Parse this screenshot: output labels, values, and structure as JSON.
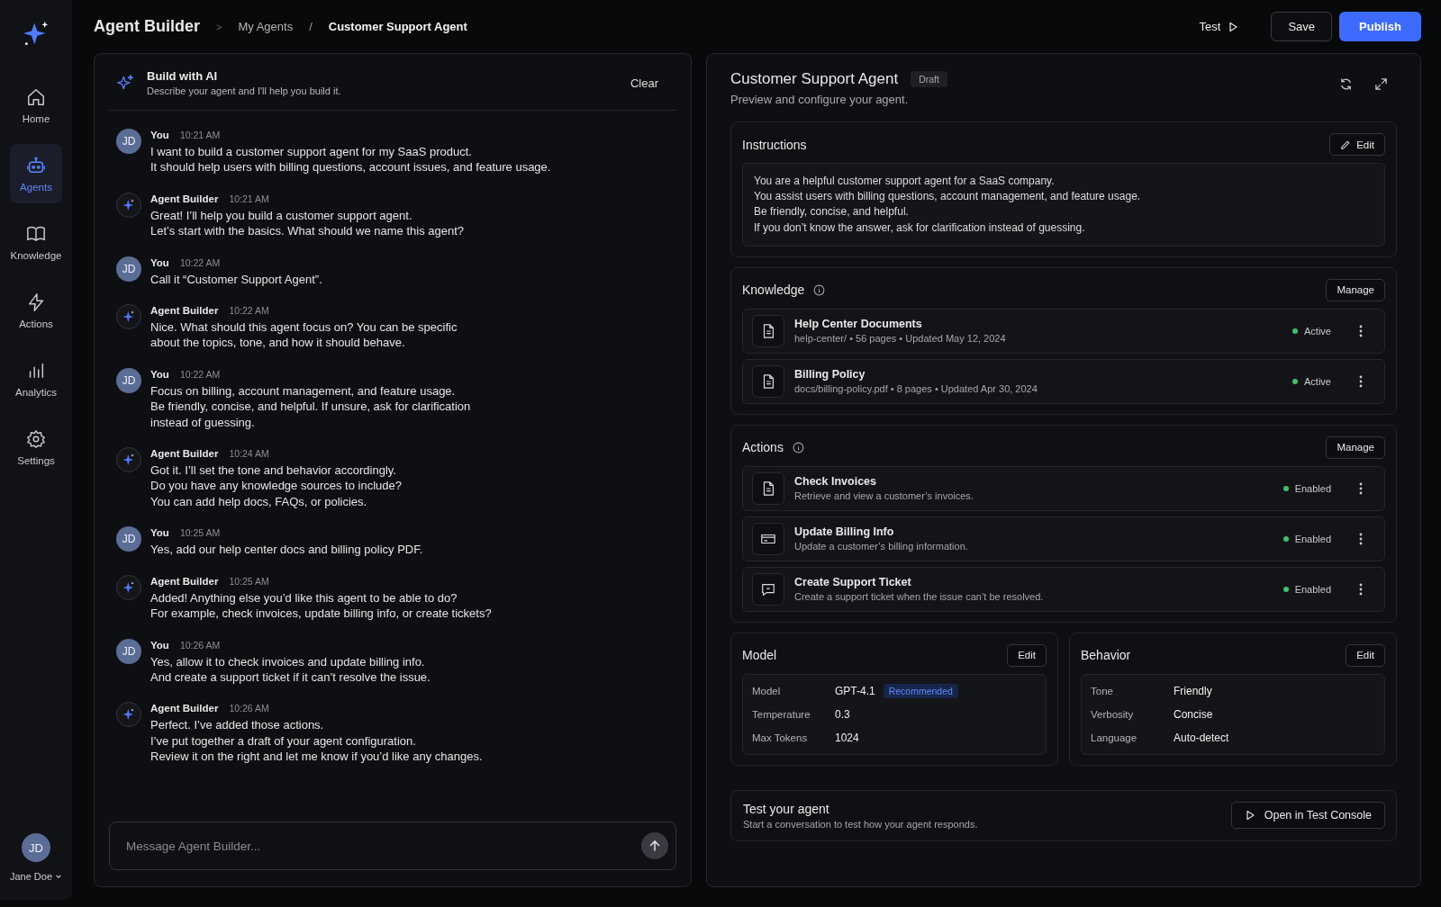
{
  "sidebar": {
    "items": [
      {
        "label": "Home",
        "selected": false
      },
      {
        "label": "Agents",
        "selected": true
      },
      {
        "label": "Knowledge",
        "selected": false
      },
      {
        "label": "Actions",
        "selected": false
      },
      {
        "label": "Analytics",
        "selected": false
      },
      {
        "label": "Settings",
        "selected": false
      }
    ],
    "user": {
      "initials": "JD",
      "name": "Jane Doe"
    }
  },
  "header": {
    "title": "Agent Builder",
    "breadcrumb": [
      "My Agents",
      "Customer Support Agent"
    ],
    "separator_1": ">",
    "separator_2": "/",
    "test": "Test",
    "save": "Save",
    "publish": "Publish"
  },
  "chat": {
    "title": "Build with AI",
    "subtitle": "Describe your agent and I'll help you build it.",
    "clear": "Clear",
    "messages": [
      {
        "kind": "user",
        "avatar": "JD",
        "author": "You",
        "time": "10:21 AM",
        "lines": [
          "I want to build a customer support agent for my SaaS product.",
          "It should help users with billing questions, account issues, and feature usage."
        ]
      },
      {
        "kind": "agent",
        "author": "Agent Builder",
        "time": "10:21 AM",
        "lines": [
          "Great! I’ll help you build a customer support agent.",
          "Let’s start with the basics. What should we name this agent?"
        ]
      },
      {
        "kind": "user",
        "avatar": "JD",
        "author": "You",
        "time": "10:22 AM",
        "lines": [
          "Call it “Customer Support Agent”."
        ]
      },
      {
        "kind": "agent",
        "author": "Agent Builder",
        "time": "10:22 AM",
        "lines": [
          "Nice. What should this agent focus on? You can be specific",
          "about the topics, tone, and how it should behave."
        ]
      },
      {
        "kind": "user",
        "avatar": "JD",
        "author": "You",
        "time": "10:22 AM",
        "lines": [
          "Focus on billing, account management, and feature usage.",
          "Be friendly, concise, and helpful. If unsure, ask for clarification",
          "instead of guessing."
        ]
      },
      {
        "kind": "agent",
        "author": "Agent Builder",
        "time": "10:24 AM",
        "lines": [
          "Got it. I’ll set the tone and behavior accordingly.",
          "Do you have any knowledge sources to include?",
          "You can add help docs, FAQs, or policies."
        ]
      },
      {
        "kind": "user",
        "avatar": "JD",
        "author": "You",
        "time": "10:25 AM",
        "lines": [
          "Yes, add our help center docs and billing policy PDF."
        ]
      },
      {
        "kind": "agent",
        "author": "Agent Builder",
        "time": "10:25 AM",
        "lines": [
          "Added! Anything else you’d like this agent to be able to do?",
          "For example, check invoices, update billing info, or create tickets?"
        ]
      },
      {
        "kind": "user",
        "avatar": "JD",
        "author": "You",
        "time": "10:26 AM",
        "lines": [
          "Yes, allow it to check invoices and update billing info.",
          "And create a support ticket if it can’t resolve the issue."
        ]
      },
      {
        "kind": "agent",
        "author": "Agent Builder",
        "time": "10:26 AM",
        "lines": [
          "Perfect. I’ve added those actions.",
          "I’ve put together a draft of your agent configuration.",
          "Review it on the right and let me know if you’d like any changes."
        ]
      }
    ],
    "input": {
      "placeholder": "Message Agent Builder..."
    }
  },
  "preview": {
    "title": "Customer Support Agent",
    "badge": "Draft",
    "subtitle": "Preview and configure your agent.",
    "instructions": {
      "title": "Instructions",
      "edit": "Edit",
      "lines": [
        "You are a helpful customer support agent for a SaaS company.",
        "You assist users with billing questions, account management, and feature usage.",
        "Be friendly, concise, and helpful.",
        "If you don’t know the answer, ask for clarification instead of guessing."
      ]
    },
    "knowledge": {
      "title": "Knowledge",
      "manage": "Manage",
      "items": [
        {
          "name": "Help Center Documents",
          "meta": "help-center/ • 56 pages • Updated May 12, 2024",
          "status": "Active"
        },
        {
          "name": "Billing Policy",
          "meta": "docs/billing-policy.pdf • 8 pages • Updated Apr 30, 2024",
          "status": "Active"
        }
      ]
    },
    "actions": {
      "title": "Actions",
      "manage": "Manage",
      "items": [
        {
          "name": "Check Invoices",
          "meta": "Retrieve and view a customer’s invoices.",
          "status": "Enabled"
        },
        {
          "name": "Update Billing Info",
          "meta": "Update a customer’s billing information.",
          "status": "Enabled"
        },
        {
          "name": "Create Support Ticket",
          "meta": "Create a support ticket when the issue can’t be resolved.",
          "status": "Enabled"
        }
      ]
    },
    "model": {
      "title": "Model",
      "edit": "Edit",
      "rows": [
        {
          "label": "Model",
          "value": "GPT-4.1",
          "badge": "Recommended"
        },
        {
          "label": "Temperature",
          "value": "0.3"
        },
        {
          "label": "Max Tokens",
          "value": "1024"
        }
      ]
    },
    "behavior": {
      "title": "Behavior",
      "edit": "Edit",
      "rows": [
        {
          "label": "Tone",
          "value": "Friendly"
        },
        {
          "label": "Verbosity",
          "value": "Concise"
        },
        {
          "label": "Language",
          "value": "Auto-detect"
        }
      ]
    },
    "test": {
      "title": "Test your agent",
      "subtitle": "Start a conversation to test how your agent responds.",
      "button": "Open in Test Console"
    }
  }
}
